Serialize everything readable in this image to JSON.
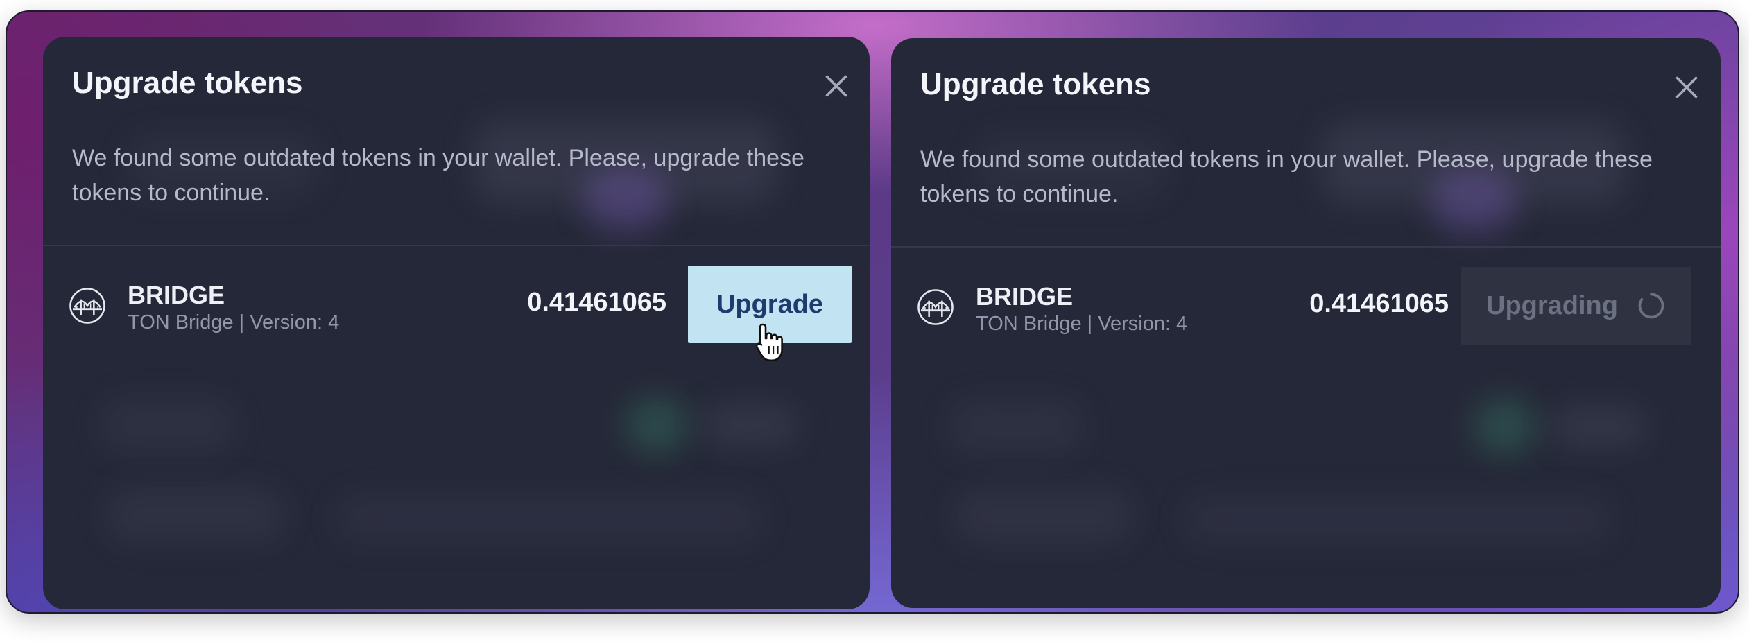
{
  "icons": {
    "close": "close-icon",
    "token": "bridge-icon",
    "spinner": "spinner-icon",
    "cursor": "hand-pointer-cursor"
  },
  "colors": {
    "modal_bg": "#252838",
    "upgrade_button_bg": "#c2e3f2",
    "upgrade_button_text": "#1f3a6d",
    "upgrading_button_bg": "#2f3341"
  },
  "modals": [
    {
      "state": "ready",
      "title": "Upgrade tokens",
      "description": "We found some outdated tokens in your wallet. Please, upgrade these tokens to continue.",
      "token": {
        "name": "BRIDGE",
        "subtitle": "TON Bridge | Version: 4",
        "amount": "0.41461065"
      },
      "button_label": "Upgrade"
    },
    {
      "state": "upgrading",
      "title": "Upgrade tokens",
      "description": "We found some outdated tokens in your wallet. Please, upgrade these tokens to continue.",
      "token": {
        "name": "BRIDGE",
        "subtitle": "TON Bridge | Version: 4",
        "amount": "0.41461065"
      },
      "button_label": "Upgrading"
    }
  ]
}
